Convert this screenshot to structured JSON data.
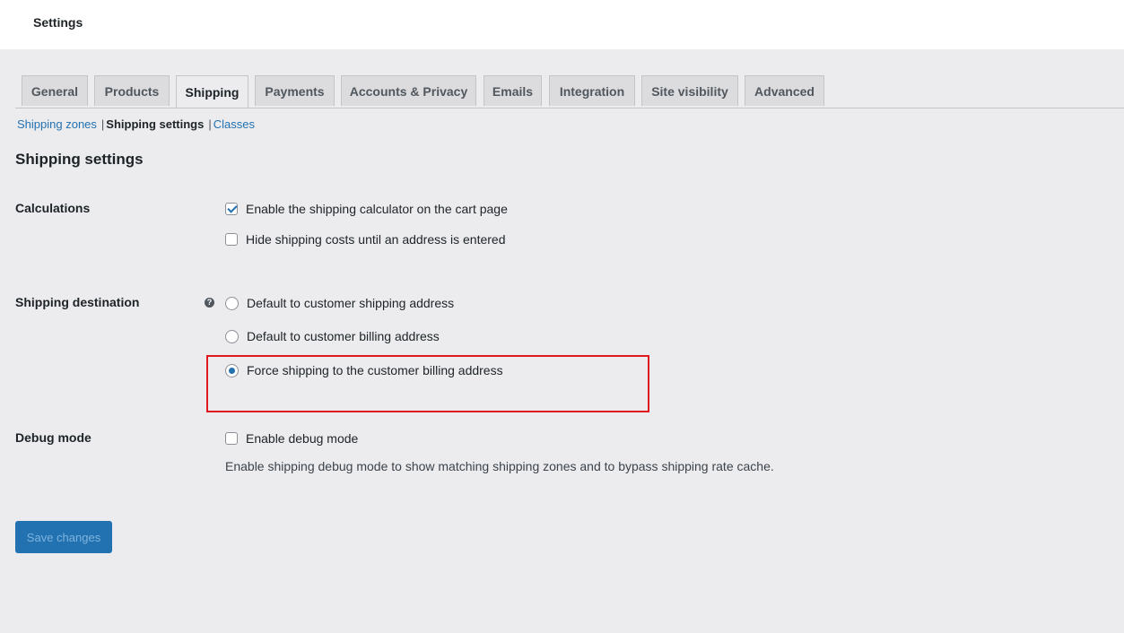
{
  "header": {
    "title": "Settings"
  },
  "tabs": [
    {
      "label": "General"
    },
    {
      "label": "Products"
    },
    {
      "label": "Shipping"
    },
    {
      "label": "Payments"
    },
    {
      "label": "Accounts & Privacy"
    },
    {
      "label": "Emails"
    },
    {
      "label": "Integration"
    },
    {
      "label": "Site visibility"
    },
    {
      "label": "Advanced"
    }
  ],
  "active_tab": "Shipping",
  "subnav": {
    "zones": "Shipping zones",
    "settings": "Shipping settings",
    "classes": "Classes",
    "separator": "|"
  },
  "section_title": "Shipping settings",
  "calculations": {
    "label": "Calculations",
    "options": [
      {
        "label": "Enable the shipping calculator on the cart page",
        "checked": true
      },
      {
        "label": "Hide shipping costs until an address is entered",
        "checked": false
      }
    ]
  },
  "destination": {
    "label": "Shipping destination",
    "help": "?",
    "options": [
      {
        "label": "Default to customer shipping address",
        "selected": false
      },
      {
        "label": "Default to customer billing address",
        "selected": false
      },
      {
        "label": "Force shipping to the customer billing address",
        "selected": true
      }
    ]
  },
  "debug": {
    "label": "Debug mode",
    "option": {
      "label": "Enable debug mode",
      "checked": false
    },
    "description": "Enable shipping debug mode to show matching shipping zones and to bypass shipping rate cache."
  },
  "save_button": "Save changes",
  "colors": {
    "accent": "#2271b1",
    "background": "#ececef",
    "highlight": "#e0191e"
  }
}
